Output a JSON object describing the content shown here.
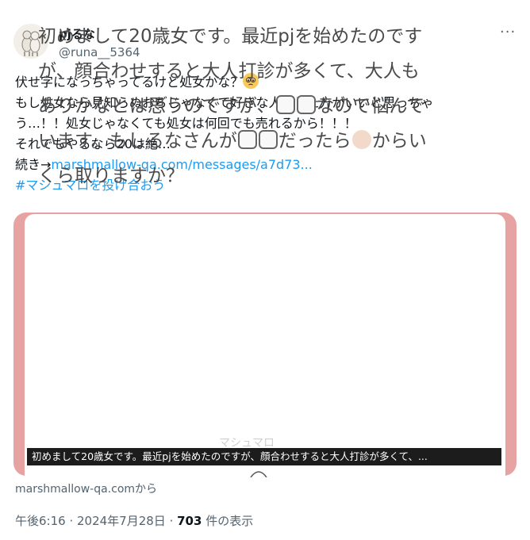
{
  "user": {
    "display_name": "pjるな",
    "handle": "@runa__5364",
    "avatar_icon": "alpaca-avatar-icon"
  },
  "more_label": "···",
  "tweet": {
    "lines": [
      "伏せ字になっちゃってるけど処女かな？",
      "もし処女なら見知らぬおぢじゃなくて好きな人とした方がいいと思っちゃ",
      "う…！！処女じゃなくても処女は何回でも売れるから！！！",
      "それでもやるなら20は絶…"
    ],
    "continue_prefix": "続き→",
    "continue_link": "marshmallow-qa.com/messages/a7d73...",
    "hashtag": "#マシュマロを投げ合おう"
  },
  "card": {
    "question_lines": {
      "l1": "初めまして20歳女です。最近pjを始めたのです",
      "l2": "が、顔合わせすると大人打診が多くて、大人も",
      "l3a": "ありかなとは思うのですが、",
      "l3b": "なので悩んで",
      "l4a": "います。もしるなさんが",
      "l4b": "だったら",
      "l4c": "からい",
      "l5": "くら取りますか？"
    },
    "watermark": "マシュマロ",
    "caption": "初めまして20歳女です。最近pjを始めたのですが、顔合わせすると大人打診が多くて、..."
  },
  "source_text": "marshmallow-qa.comから",
  "meta": {
    "time": "午後6:16",
    "date": "2024年7月28日",
    "views_count": "703",
    "views_label": "件の表示"
  },
  "colors": {
    "link": "#1d9bf0",
    "card_border": "#e7a2a2",
    "muted": "#536471"
  }
}
